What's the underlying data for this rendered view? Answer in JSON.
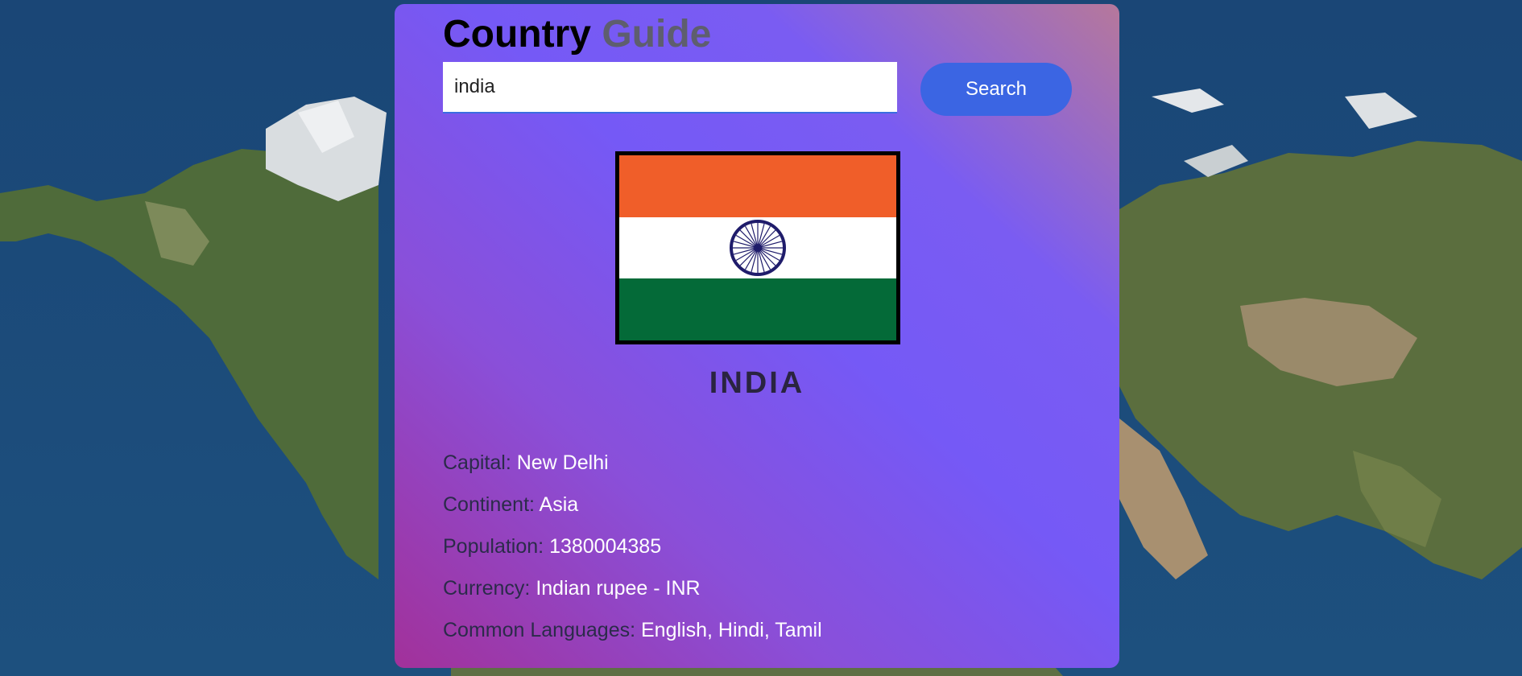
{
  "app": {
    "title_main": "Country",
    "title_accent": "Guide"
  },
  "search": {
    "value": "india",
    "button_label": "Search"
  },
  "country": {
    "name": "INDIA",
    "flag_colors": {
      "saffron": "#f05e29",
      "white": "#ffffff",
      "green": "#046a38",
      "chakra": "#1f1c6b"
    },
    "details": [
      {
        "label": "Capital:",
        "value": "New Delhi"
      },
      {
        "label": "Continent:",
        "value": "Asia"
      },
      {
        "label": "Population:",
        "value": "1380004385"
      },
      {
        "label": "Currency:",
        "value": "Indian rupee - INR"
      },
      {
        "label": "Common Languages:",
        "value": "English, Hindi, Tamil"
      }
    ]
  },
  "colors": {
    "button": "#3b65e3",
    "card_gradient": [
      "#a2319a",
      "#7559f6",
      "#b6789b"
    ]
  }
}
